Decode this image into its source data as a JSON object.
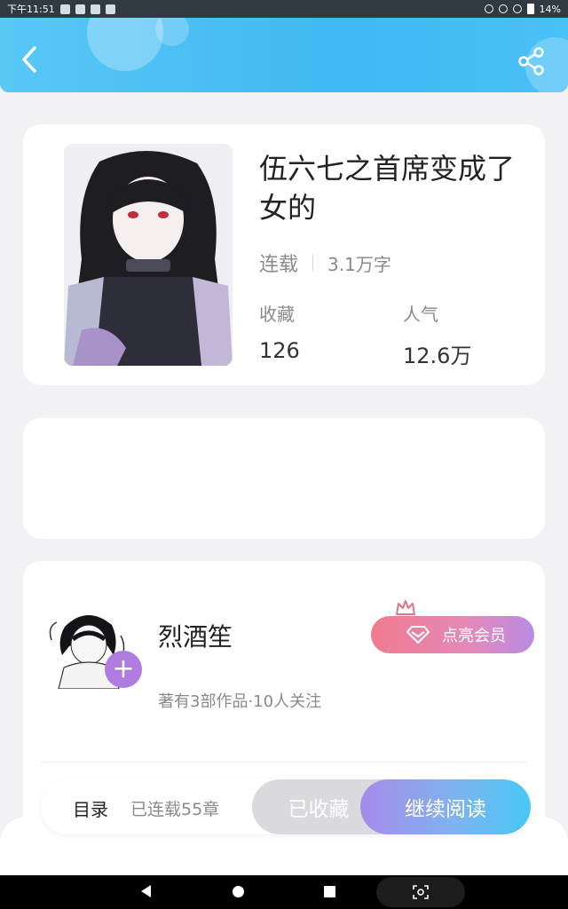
{
  "status_bar": {
    "time": "下午11:51",
    "battery": "14%"
  },
  "book": {
    "title": "伍六七之首席变成了女的",
    "status": "连载",
    "word_count": "3.1万字",
    "favorites_label": "收藏",
    "favorites_value": "126",
    "popularity_label": "人气",
    "popularity_value": "12.6万"
  },
  "author": {
    "name": "烈酒笙",
    "info": "著有3部作品·10人关注",
    "vip_button": "点亮会员"
  },
  "actions": {
    "toc_label": "目录",
    "chapter_count": "已连载55章",
    "collected_label": "已收藏",
    "read_label": "继续阅读"
  },
  "colors": {
    "header": "#41b8f3",
    "vip_start": "#f07a8e",
    "vip_end": "#b98be3",
    "read_start": "#a68bea",
    "read_end": "#47c8f4",
    "collected": "#d9d9de"
  },
  "icons": {
    "back": "back-arrow-icon",
    "share": "share-icon",
    "plus": "plus-icon",
    "crown": "crown-icon",
    "diamond": "diamond-icon"
  }
}
